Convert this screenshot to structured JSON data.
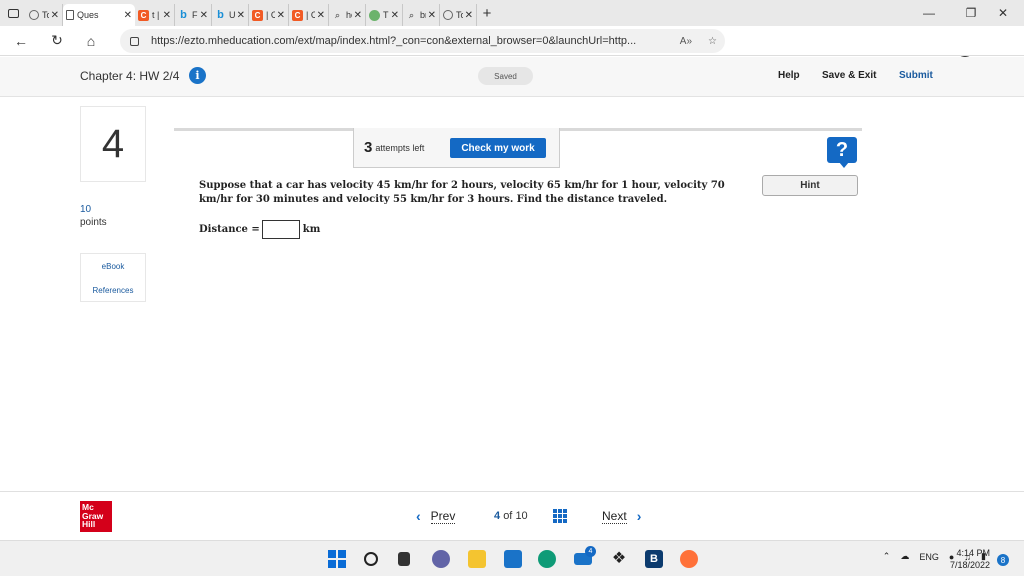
{
  "browser": {
    "tabs": [
      {
        "title": "Top F",
        "icon": "globe-icon"
      },
      {
        "title": "Ques",
        "icon": "page-icon",
        "active": true
      },
      {
        "title": "t | Ch",
        "icon": "chegg-icon"
      },
      {
        "title": "Find",
        "icon": "bing-icon"
      },
      {
        "title": "Use c",
        "icon": "bing-icon"
      },
      {
        "title": "| Che",
        "icon": "chegg-icon"
      },
      {
        "title": "| Che",
        "icon": "chegg-icon"
      },
      {
        "title": "how",
        "icon": "search-icon"
      },
      {
        "title": "The I",
        "icon": "green-icon"
      },
      {
        "title": "bros",
        "icon": "search-icon"
      },
      {
        "title": "Top",
        "icon": "globe-icon"
      }
    ],
    "url": "https://ezto.mheducation.com/ext/map/index.html?_con=con&external_browser=0&launchUrl=http...",
    "read_aloud": "A»"
  },
  "header": {
    "chapter": "Chapter 4: HW 2/4",
    "info": "i",
    "saved": "Saved",
    "help": "Help",
    "save_exit": "Save & Exit",
    "submit": "Submit"
  },
  "rail": {
    "question_number": "4",
    "points_value": "10",
    "points_label": "points",
    "ebook": "eBook",
    "references": "References"
  },
  "question": {
    "attempts_count": "3",
    "attempts_label": "attempts left",
    "check_work": "Check my work",
    "help_symbol": "?",
    "hint": "Hint",
    "text": "Suppose that a car has velocity 45 km/hr for 2 hours, velocity 65 km/hr for 1 hour, velocity 70 km/hr for 30 minutes and velocity 55 km/hr for 3 hours. Find the distance traveled.",
    "answer_label": "Distance =",
    "answer_value": "",
    "answer_unit": "km"
  },
  "footer": {
    "logo_lines": [
      "Mc",
      "Graw",
      "Hill"
    ],
    "prev": "Prev",
    "current": "4",
    "of_label": "of",
    "total": "10",
    "next": "Next"
  },
  "taskbar": {
    "language": "ENG",
    "time": "4:14 PM",
    "date": "7/18/2022",
    "notifications": "8",
    "mail_badge": "4"
  }
}
